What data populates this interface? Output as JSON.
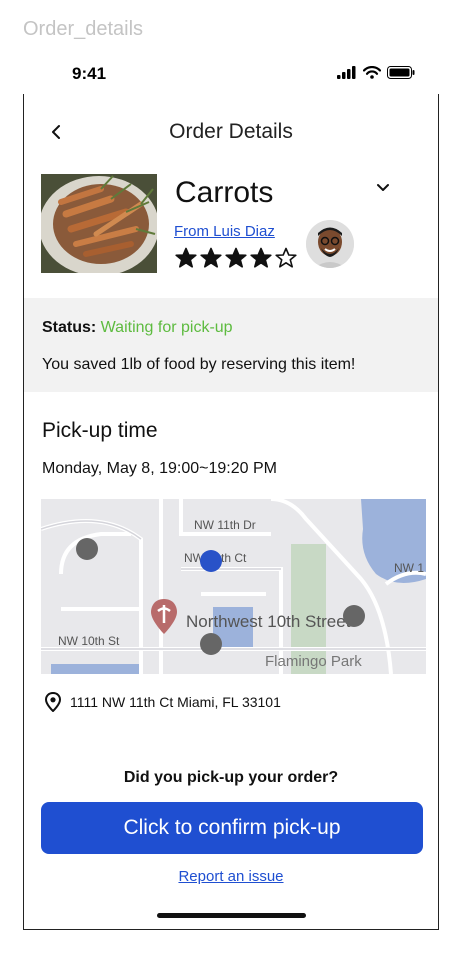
{
  "frame_label": "Order_details",
  "status_bar": {
    "time": "9:41"
  },
  "header": {
    "title": "Order Details"
  },
  "product": {
    "name": "Carrots",
    "seller_link": "From Luis Diaz",
    "rating": 4,
    "rating_max": 5
  },
  "status": {
    "label": "Status: ",
    "value": "Waiting for pick-up",
    "value_color": "#5dbb3f",
    "saved_text": "You saved 1lb of food by reserving this item!"
  },
  "pickup": {
    "heading": "Pick-up time",
    "date": "Monday, May 8, 19:00~19:20 PM"
  },
  "map": {
    "labels": {
      "nw11dr": "NW 11th Dr",
      "nw11ct_a": "NW",
      "nw11ct_b": "th Ct",
      "nw1": "NW 1",
      "nw10st": "NW 10th St",
      "street": "Northwest 10th Street",
      "park": "Flamingo Park"
    }
  },
  "address": "1111 NW 11th Ct Miami, FL 33101",
  "confirm": {
    "question": "Did you pick-up your order?",
    "button_label": "Click to confirm pick-up",
    "button_color": "#1f4fd1"
  },
  "report_link": "Report an issue"
}
